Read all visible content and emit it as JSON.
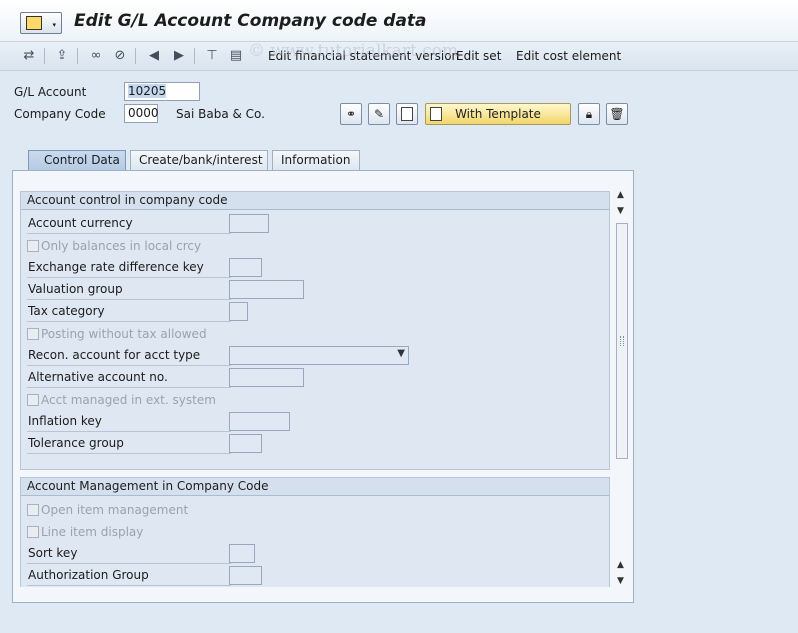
{
  "window": {
    "title": "Edit G/L Account Company code data"
  },
  "toolbar": {
    "watermark": "© www.tutorialkart.com",
    "edit_fsv": "Edit financial statement version",
    "edit_set": "Edit set",
    "edit_cost_element": "Edit cost element"
  },
  "header": {
    "gl_account_label": "G/L Account",
    "gl_account_value": "10205",
    "company_code_label": "Company Code",
    "company_code_value": "0000",
    "company_name": "Sai Baba & Co.",
    "with_template_label": "With Template"
  },
  "tabs": [
    {
      "label": "Control Data"
    },
    {
      "label": "Create/bank/interest"
    },
    {
      "label": "Information"
    }
  ],
  "group1": {
    "title": "Account control in company code",
    "account_currency": "Account currency",
    "only_balances": "Only balances in local crcy",
    "exchange_rate_key": "Exchange rate difference key",
    "valuation_group": "Valuation group",
    "tax_category": "Tax category",
    "posting_without_tax": "Posting without tax allowed",
    "recon_account": "Recon. account for acct type",
    "alternative_account": "Alternative account no.",
    "acct_managed_ext": "Acct managed in ext. system",
    "inflation_key": "Inflation key",
    "tolerance_group": "Tolerance group"
  },
  "group2": {
    "title": "Account Management in Company Code",
    "open_item_mgmt": "Open item management",
    "line_item_display": "Line item display",
    "sort_key": "Sort key",
    "authorization_group": "Authorization Group"
  }
}
